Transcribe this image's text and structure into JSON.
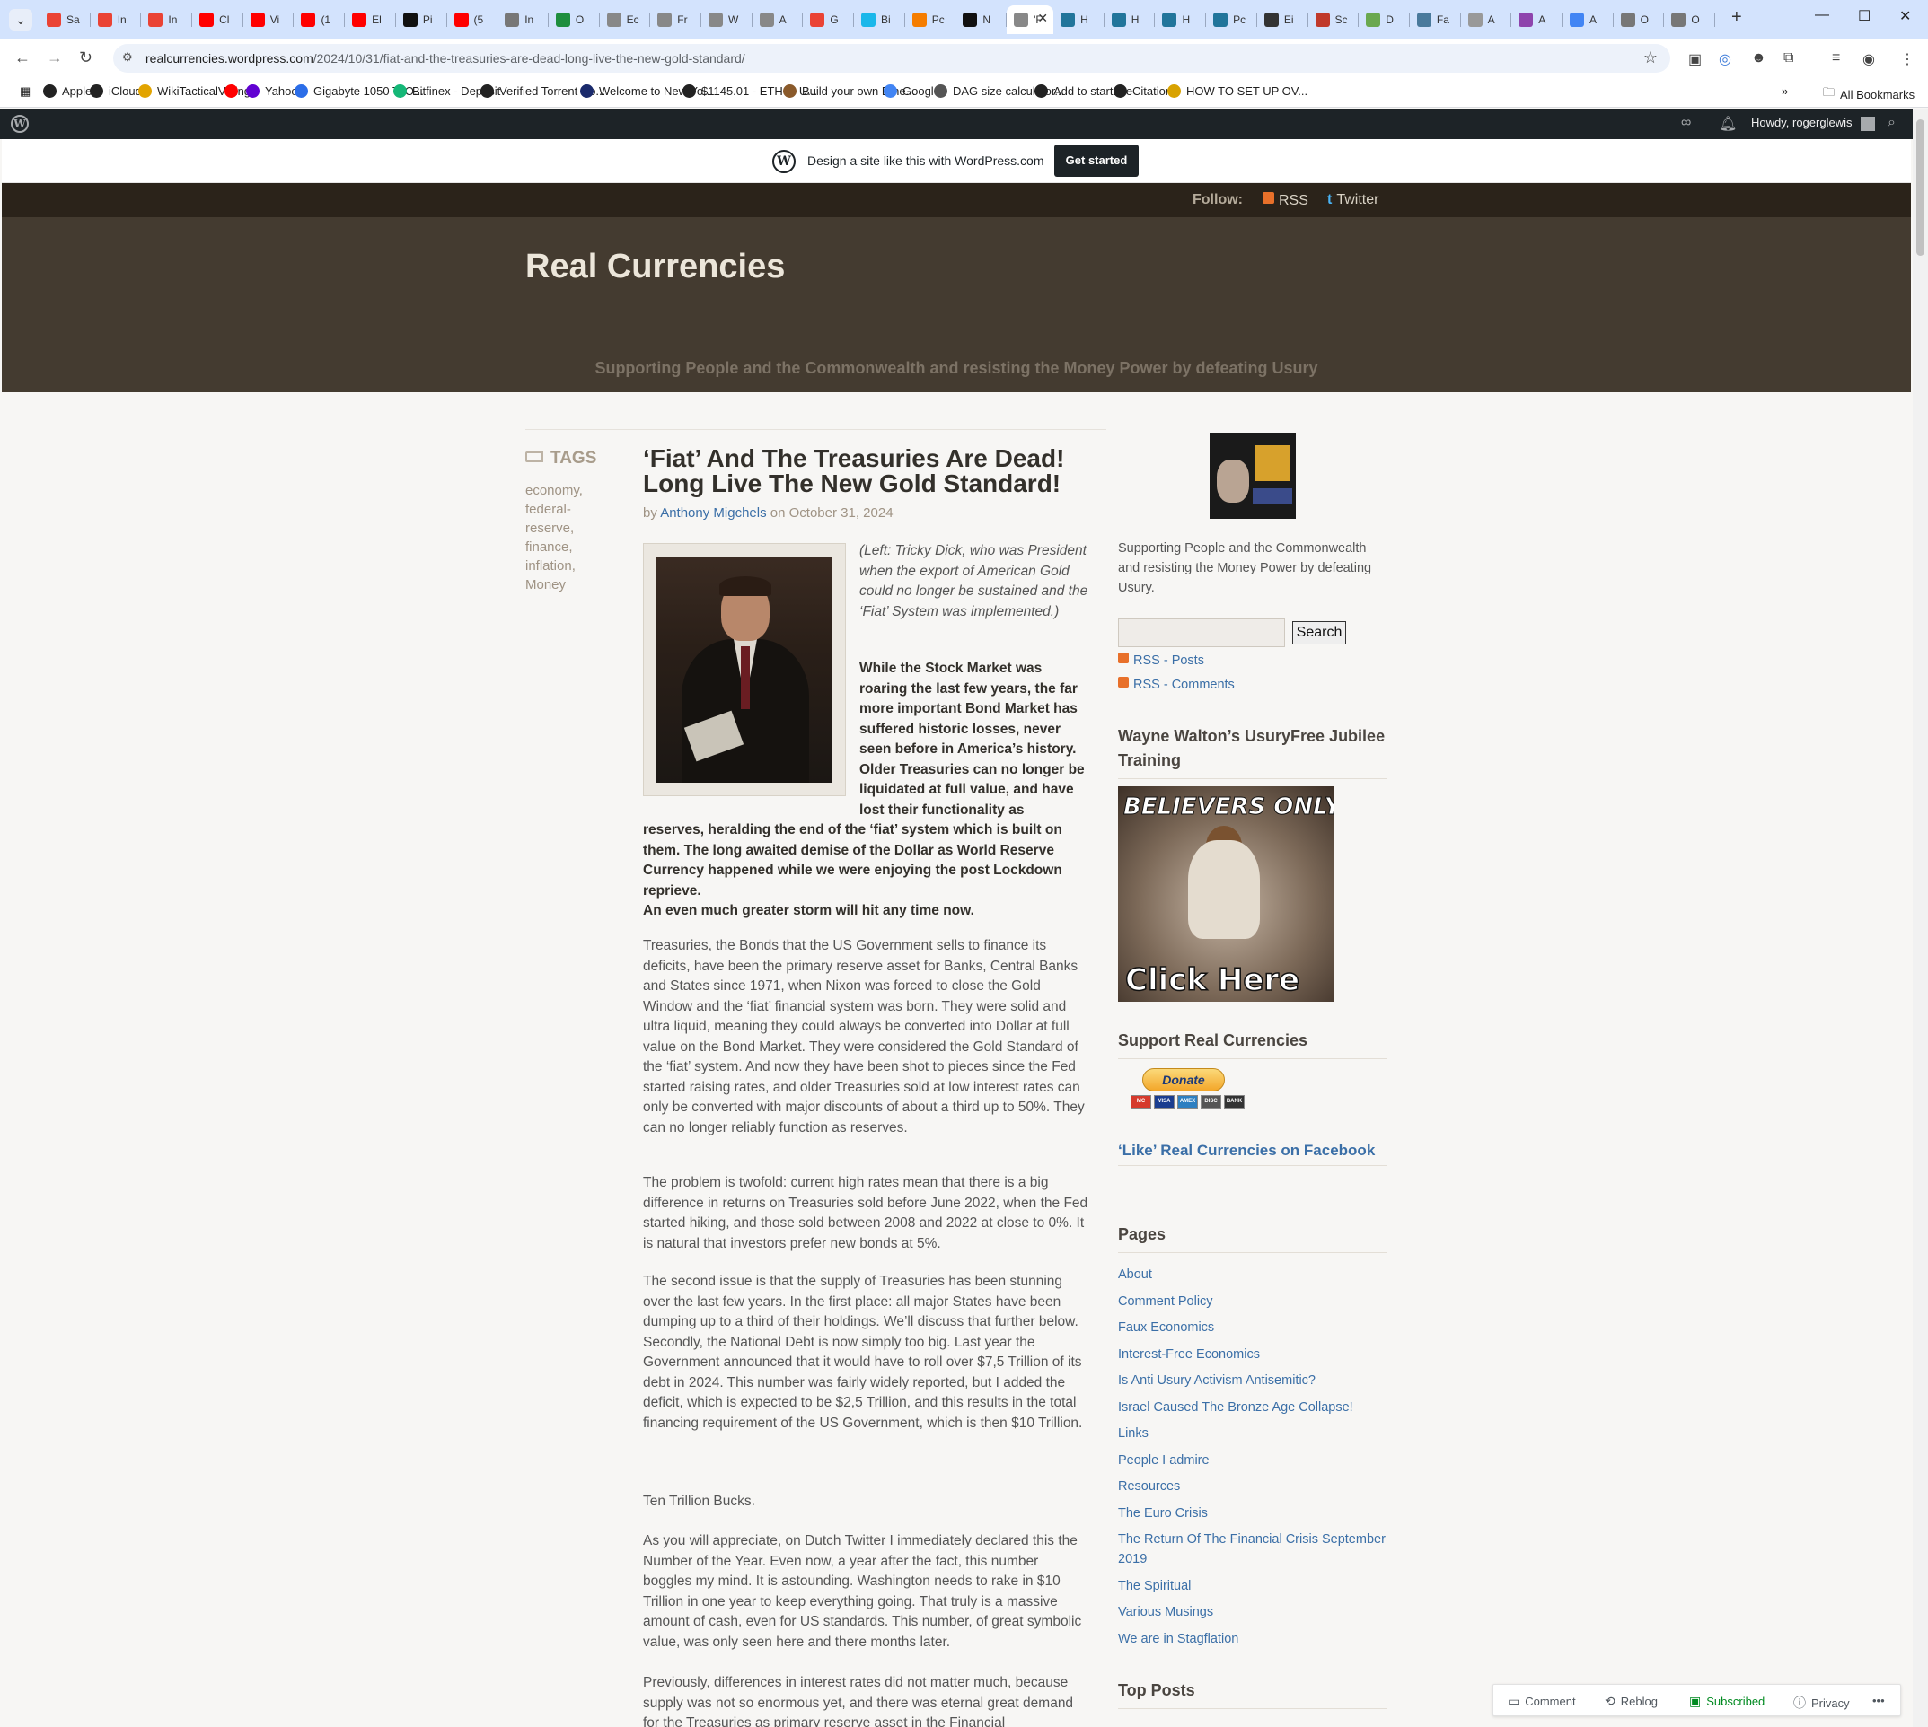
{
  "browser": {
    "tabs": [
      {
        "label": "Sa",
        "icon": "gmail-icon",
        "color": "#ea4335"
      },
      {
        "label": "In",
        "icon": "gmail-icon",
        "color": "#ea4335"
      },
      {
        "label": "In",
        "icon": "gmail-icon",
        "color": "#ea4335"
      },
      {
        "label": "Cl",
        "icon": "youtube-icon",
        "color": "#ff0000"
      },
      {
        "label": "Vi",
        "icon": "youtube-icon",
        "color": "#ff0000"
      },
      {
        "label": "(1",
        "icon": "youtube-icon",
        "color": "#ff0000"
      },
      {
        "label": "El",
        "icon": "youtube-icon",
        "color": "#ff0000"
      },
      {
        "label": "Pi",
        "icon": "page-icon",
        "color": "#111111"
      },
      {
        "label": "(5",
        "icon": "youtube-icon",
        "color": "#ff0000"
      },
      {
        "label": "In",
        "icon": "globe-icon",
        "color": "#777777"
      },
      {
        "label": "O",
        "icon": "drive-icon",
        "color": "#1e8e3e"
      },
      {
        "label": "Ec",
        "icon": "page-icon",
        "color": "#888888"
      },
      {
        "label": "Fr",
        "icon": "page-icon",
        "color": "#888888"
      },
      {
        "label": "W",
        "icon": "page-icon",
        "color": "#888888"
      },
      {
        "label": "A",
        "icon": "page-icon",
        "color": "#888888"
      },
      {
        "label": "G",
        "icon": "google-icon",
        "color": "#ea4335"
      },
      {
        "label": "Bi",
        "icon": "vimeo-icon",
        "color": "#1ab7ea"
      },
      {
        "label": "Pc",
        "icon": "blogger-icon",
        "color": "#f57d00"
      },
      {
        "label": "N",
        "icon": "page-icon",
        "color": "#111111"
      },
      {
        "label": "'F",
        "icon": "page-icon",
        "color": "#888888"
      },
      {
        "label": "H",
        "icon": "wordpress-icon",
        "color": "#21759b"
      },
      {
        "label": "H",
        "icon": "wordpress-icon",
        "color": "#21759b"
      },
      {
        "label": "H",
        "icon": "wordpress-icon",
        "color": "#21759b"
      },
      {
        "label": "Pc",
        "icon": "wordpress-icon",
        "color": "#21759b"
      },
      {
        "label": "Ei",
        "icon": "wikipedia-icon",
        "color": "#333333"
      },
      {
        "label": "Sc",
        "icon": "page-icon",
        "color": "#c0392b"
      },
      {
        "label": "D",
        "icon": "page-icon",
        "color": "#6aa84f"
      },
      {
        "label": "Fa",
        "icon": "page-icon",
        "color": "#4a7a9c"
      },
      {
        "label": "A",
        "icon": "page-icon",
        "color": "#999999"
      },
      {
        "label": "A",
        "icon": "page-icon",
        "color": "#8e44ad"
      },
      {
        "label": "A",
        "icon": "google-icon",
        "color": "#4285f4"
      },
      {
        "label": "O",
        "icon": "page-icon",
        "color": "#777777"
      },
      {
        "label": "O",
        "icon": "page-icon",
        "color": "#777777"
      }
    ],
    "active_tab_index": 19,
    "url_host": "realcurrencies.wordpress.com",
    "url_path": "/2024/10/31/fiat-and-the-treasuries-are-dead-long-live-the-new-gold-standard/",
    "bookmarks": [
      "Apple",
      "iCloud",
      "WikiTacticalVoting",
      "",
      "Yahoo",
      "Gigabyte 1050 Ti O...",
      "Bitfinex - Deposit",
      "Verified Torrent Do...",
      "Welcome to New Yo...",
      "$1145.01 - ETH to U...",
      "Build your own Ethe...",
      "Google",
      "DAG size calculator...",
      "Add to start.me",
      "Citation",
      "HOW TO SET UP OV..."
    ],
    "all_bookmarks": "All Bookmarks"
  },
  "adminbar": {
    "howdy": "Howdy, rogerglewis"
  },
  "promo": {
    "text": "Design a site like this with WordPress.com",
    "button": "Get started"
  },
  "site": {
    "follow_label": "Follow:",
    "rss": "RSS",
    "twitter": "Twitter",
    "title": "Real Currencies",
    "description": "Supporting People and the Commonwealth and resisting the Money Power by defeating Usury"
  },
  "tags": {
    "heading": "TAGS",
    "items": [
      "economy,",
      "federal-",
      "reserve,",
      "finance,",
      "inflation,",
      "Money"
    ]
  },
  "post": {
    "title": "‘Fiat’ And The Treasuries Are Dead! Long Live The New Gold Standard!",
    "by": "by",
    "author": "Anthony Migchels",
    "on": "on",
    "date": "October 31, 2024",
    "caption": "(Left: Tricky Dick, who was President when the export of American Gold could no longer be sustained and the ‘Fiat’ System was implemented.)",
    "lead_narrow": "While the Stock Market was roaring the last few years, the far more important Bond Market has suffered historic losses, never seen before in America’s history. Older Treasuries can no longer be liquidated at full value, and have lost their functionality as",
    "lead_wide": "reserves, heralding the end of the ‘fiat’ system which is built on them. The long awaited demise of the Dollar as World Reserve Currency happened while we were enjoying the post Lockdown reprieve.",
    "lead_last": "An even much greater storm will hit any time now.",
    "p1": "Treasuries, the Bonds that the US Government sells to finance its deficits, have been the primary reserve asset for Banks, Central Banks and States since 1971, when Nixon was forced to close the Gold Window and the ‘fiat’ financial system was born. They were solid and ultra liquid, meaning they could always be converted into Dollar at full value on the Bond Market. They were considered the Gold Standard of the ‘fiat’ system. And now they have been shot to pieces since the Fed started raising rates, and older Treasuries sold at low interest rates can only be converted with major discounts of about a third up to 50%. They can no longer reliably function as reserves.",
    "p2": "The problem is twofold: current high rates mean that there is a big difference in returns on Treasuries sold before June 2022, when the Fed started hiking, and those sold between 2008 and 2022 at close to 0%. It is natural that investors prefer new bonds at 5%.",
    "p3a": "The second issue is that the supply of Treasuries has been stunning over the last few years. In the first place: all major States have been dumping up to a third of their holdings. We’ll discuss that further below.",
    "p3b": "Secondly, the National Debt is now simply too big. Last year the Government announced that it would have to roll over $7,5 Trillion of its debt in 2024. This number was fairly widely reported, but I added the deficit, which is expected to be $2,5 Trillion, and this results in the total financing requirement of the US Government, which is then $10 Trillion.",
    "p4": "Ten Trillion Bucks.",
    "p5": "As you will appreciate, on Dutch Twitter I immediately declared this the Number of the Year. Even now, a year after the fact, this number boggles my mind. It is astounding. Washington needs to rake in $10 Trillion in one year to keep everything going. That truly is a massive amount of cash, even for US standards. This number, of great symbolic value, was only seen here and there months later.",
    "p6": "Previously, differences in interest rates did not matter much, because supply was not so enormous yet, and there was eternal great demand for the Treasuries as primary reserve asset in the Financial"
  },
  "sidebar": {
    "description": "Supporting People and the Commonwealth and resisting the Money Power by defeating Usury.",
    "search_button": "Search",
    "rss_posts": "RSS - Posts",
    "rss_comments": "RSS - Comments",
    "ufj_title": "Wayne Walton’s UsuryFree Jubilee Training",
    "believers_top": "BELIEVERS ONLY!",
    "believers_bottom": "Click Here",
    "support_title": "Support Real Currencies",
    "donate": "Donate",
    "card_labels": [
      "MC",
      "VISA",
      "AMEX",
      "DISC",
      "BANK"
    ],
    "facebook": "‘Like’ Real Currencies on Facebook",
    "pages_title": "Pages",
    "pages": [
      "About",
      "Comment Policy",
      "Faux Economics",
      "Interest-Free Economics",
      "Is Anti Usury Activism Antisemitic?",
      "Israel Caused The Bronze Age Collapse!",
      "Links",
      "People I admire",
      "Resources",
      "The Euro Crisis",
      "The Return Of The Financial Crisis September 2019",
      "The Spiritual",
      "Various Musings",
      "We are in Stagflation"
    ],
    "top_posts_title": "Top Posts"
  },
  "actionbar": {
    "comment": "Comment",
    "reblog": "Reblog",
    "subscribed": "Subscribed",
    "privacy": "Privacy",
    "more": "•••"
  },
  "colors": {
    "header_bg": "#443b30",
    "follow_bg": "#2b231a",
    "link": "#3b6fa7",
    "admin_bg": "#1d2327"
  }
}
